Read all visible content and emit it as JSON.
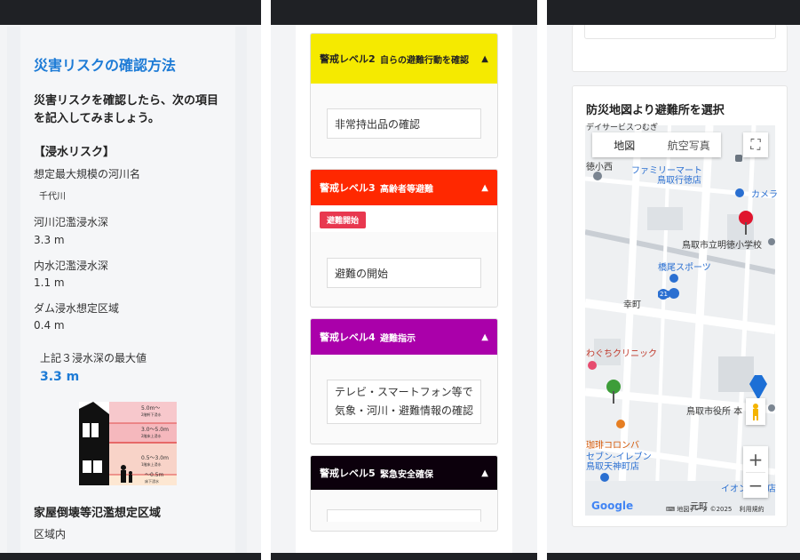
{
  "panel1": {
    "title": "災害リスクの確認方法",
    "lead": "災害リスクを確認したら、次の項目を記入してみましょう。",
    "flood_heading": "【浸水リスク】",
    "fields": [
      {
        "label": "想定最大規模の河川名",
        "value": "千代川"
      },
      {
        "label": "河川氾濫浸水深",
        "value": "3.3 m"
      },
      {
        "label": "内水氾濫浸水深",
        "value": "1.1 m"
      },
      {
        "label": "ダム浸水想定区域",
        "value": "0.4 m"
      }
    ],
    "max_label": "上記３浸水深の最大値",
    "max_value": "3.3 m",
    "figure": {
      "bands": [
        "5.0m～",
        "3.0～5.0m",
        "0.5～3.0m",
        "～0.5m"
      ],
      "band_notes": [
        "2階軒下浸水",
        "2階床上浸水",
        "1階床上浸水",
        "床下浸水"
      ]
    },
    "collapse_heading": "家屋倒壊等氾濫想定区域",
    "collapse_value": "区域内"
  },
  "panel2": {
    "levels": [
      {
        "name": "警戒レベル2",
        "desc": "自らの避難行動を確認",
        "box": "非常持出品の確認",
        "bg": "#f5ea00",
        "fg": "#222222"
      },
      {
        "name": "警戒レベル3",
        "desc": "高齢者等避難",
        "badge": "避難開始",
        "box": "避難の開始",
        "bg": "#ff2800",
        "fg": "#ffffff"
      },
      {
        "name": "警戒レベル4",
        "desc": "避難指示",
        "box": "テレビ・スマートフォン等で気象・河川・避難情報の確認",
        "bg": "#aa00aa",
        "fg": "#ffffff"
      },
      {
        "name": "警戒レベル5",
        "desc": "緊急安全確保",
        "box": "",
        "bg": "#0c000c",
        "fg": "#ffffff"
      }
    ]
  },
  "panel3": {
    "title": "防災地図より避難所を選択",
    "map_tabs": [
      "地図",
      "航空写真"
    ],
    "map_labels": {
      "top": "デイサービスつむぎ",
      "l1": "徳小西",
      "family": "ファミリーマート",
      "family2": "鳥取行徳店",
      "camera": "カメラ",
      "school": "鳥取市立明徳小学校",
      "bridge": "橋尾スポーツ",
      "town": "幸町",
      "route": "21",
      "clinic": "わぐちクリニック",
      "cityhall": "鳥取市役所 本",
      "colomba": "珈琲コロンバ",
      "seven": "セブン-イレブン",
      "seven2": "鳥取天神町店",
      "aeon": "イオン",
      "eon2": "店",
      "town2": "元町"
    },
    "google": "Google",
    "map_data": "地図データ ©2025",
    "terms": "利用規約"
  }
}
